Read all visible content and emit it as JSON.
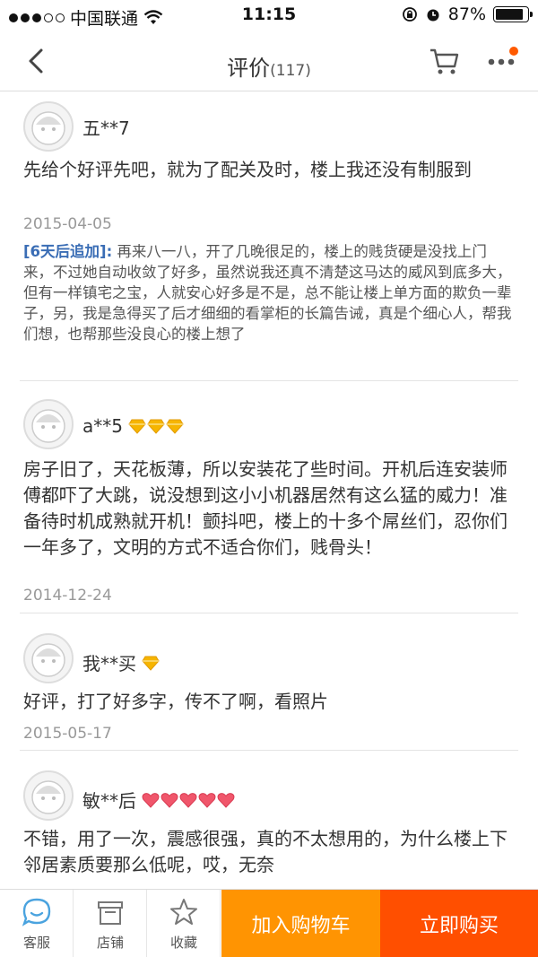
{
  "status_bar": {
    "carrier": "中国联通",
    "time": "11:15",
    "battery": "87%",
    "battery_level": 0.87
  },
  "nav": {
    "title": "评价",
    "count": "(117)"
  },
  "reviews": [
    {
      "username": "五**7",
      "badges": [],
      "content": "先给个好评先吧，就为了配关及时，楼上我还没有制服到",
      "date": "2015-04-05",
      "followup_label": "[6天后追加]:",
      "followup_text": "再来八一八，开了几晚很足的，楼上的贱货硬是没找上门来，不过她自动收敛了好多，虽然说我还真不清楚这马达的威风到底多大，但有一样镇宅之宝，人就安心好多是不是，总不能让楼上单方面的欺负一辈子，另，我是急得买了后才细细的看掌柜的长篇告诫，真是个细心人，帮我们想，也帮那些没良心的楼上想了"
    },
    {
      "username": "a**5",
      "badges": [
        "gold-diamond",
        "gold-diamond",
        "gold-diamond"
      ],
      "content": "房子旧了，天花板薄，所以安装花了些时间。开机后连安装师傅都吓了大跳，说没想到这小小机器居然有这么猛的威力！准备待时机成熟就开机！颤抖吧，楼上的十多个屌丝们，忍你们一年多了，文明的方式不适合你们，贱骨头！",
      "date": "2014-12-24"
    },
    {
      "username": "我**买",
      "badges": [
        "gold-diamond"
      ],
      "content": "好评，打了好多字，传不了啊，看照片",
      "date": "2015-05-17"
    },
    {
      "username": "敏**后",
      "badges": [
        "red-heart",
        "red-heart",
        "red-heart",
        "red-heart",
        "red-heart"
      ],
      "content": "不错，用了一次，震感很强，真的不太想用的，为什么楼上下邻居素质要那么低呢，哎，无奈",
      "date": ""
    }
  ],
  "bottom_bar": {
    "service": "客服",
    "shop": "店铺",
    "favorite": "收藏",
    "add_to_cart": "加入购物车",
    "buy_now": "立即购买"
  },
  "colors": {
    "accent_orange": "#ff9402",
    "buy_red": "#ff4f00",
    "service_blue": "#4aa3df",
    "followup_blue": "#3a6db5"
  }
}
